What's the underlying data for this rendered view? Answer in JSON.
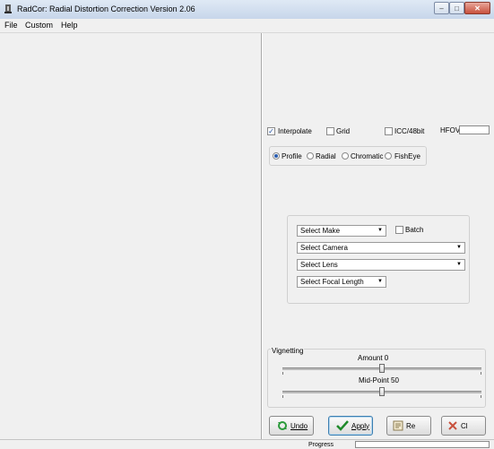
{
  "window": {
    "title": "RadCor: Radial Distortion Correction Version 2.06",
    "min_label": "–",
    "max_label": "□",
    "close_label": "✕"
  },
  "menu": {
    "file": "File",
    "custom": "Custom",
    "help": "Help"
  },
  "options": {
    "interpolate": {
      "label": "Interpolate",
      "checked": true
    },
    "grid": {
      "label": "Grid",
      "checked": false
    },
    "icc": {
      "label": "ICC/48bit",
      "checked": false
    },
    "hfov_label": "HFOV",
    "hfov_value": ""
  },
  "modes": [
    {
      "label": "Profile",
      "selected": true
    },
    {
      "label": "Radial",
      "selected": false
    },
    {
      "label": "Chromatic",
      "selected": false
    },
    {
      "label": "FishEye",
      "selected": false
    }
  ],
  "lens": {
    "make": "Select Make",
    "batch": {
      "label": "Batch",
      "checked": false
    },
    "camera": "Select Camera",
    "lens": "Select Lens",
    "focal_length": "Select Focal Length"
  },
  "vignetting": {
    "title": "Vignetting",
    "amount_label": "Amount 0",
    "amount_value": 0,
    "midpoint_label": "Mid-Point 50",
    "midpoint_value": 50
  },
  "buttons": {
    "undo": "Undo",
    "apply": "Apply",
    "reset": "Re",
    "close": "Cl"
  },
  "status": {
    "progress_label": "Progress",
    "progress_value": 0
  },
  "colors": {
    "apply_check": "#1f8a2a",
    "undo_icon": "#2a9a3a",
    "close_button": "#c8503c"
  },
  "icons": {
    "app": "app-icon",
    "undo": "undo-arrows-icon",
    "apply": "checkmark-icon",
    "reset": "reset-icon",
    "close": "close-icon"
  }
}
